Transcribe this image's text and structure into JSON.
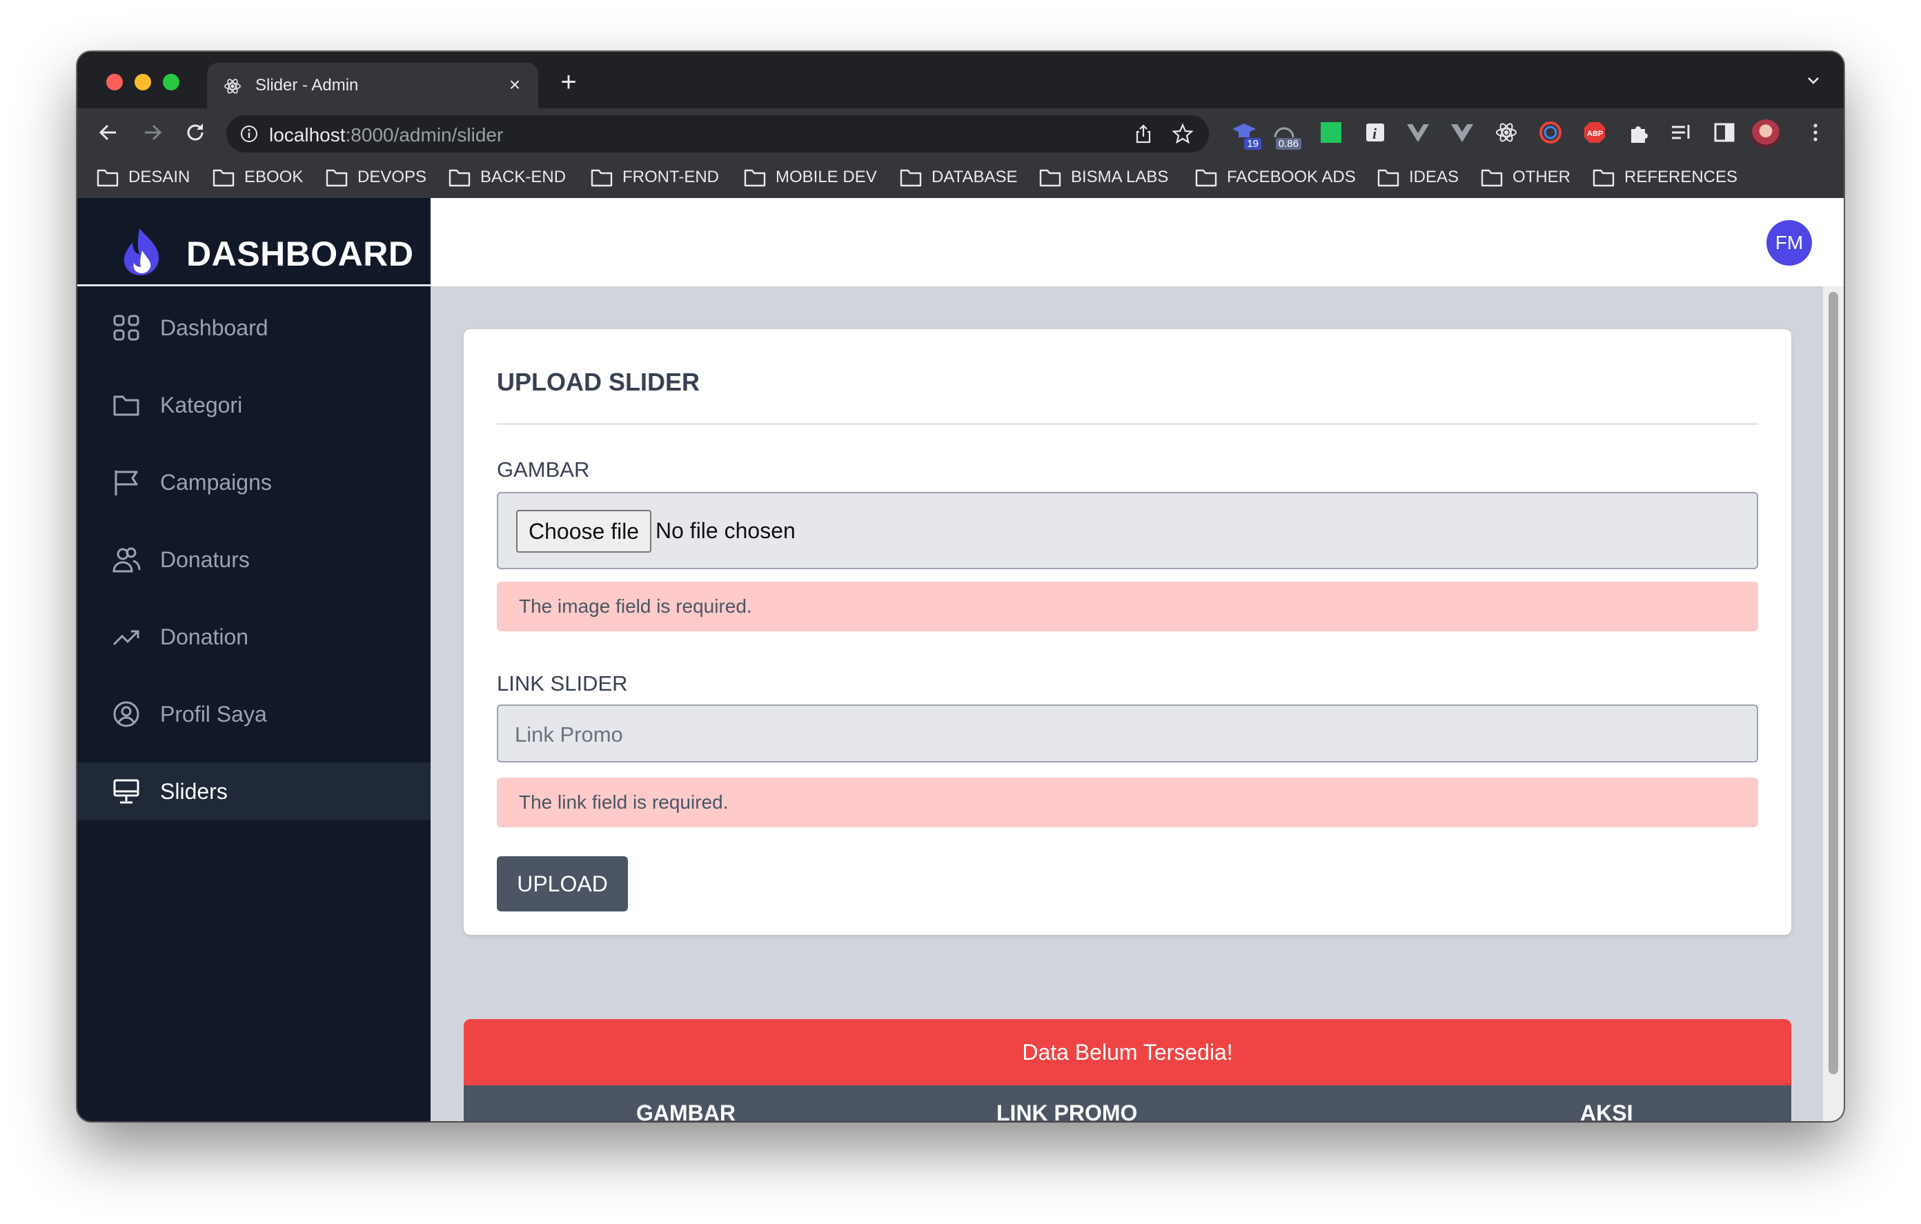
{
  "browser": {
    "tab_title": "Slider - Admin",
    "url_host": "localhost",
    "url_path": ":8000/admin/slider",
    "extensions": [
      {
        "name": "mortarboard-icon",
        "badge": "19"
      },
      {
        "name": "speed-icon",
        "badge": "0.86"
      }
    ],
    "bookmarks": [
      "DESAIN",
      "EBOOK",
      "DEVOPS",
      "BACK-END",
      "FRONT-END",
      "MOBILE DEV",
      "DATABASE",
      "BISMA LABS",
      "FACEBOOK ADS",
      "IDEAS",
      "OTHER",
      "REFERENCES"
    ]
  },
  "sidebar": {
    "brand": "DASHBOARD",
    "items": [
      {
        "label": "Dashboard",
        "icon": "grid-icon",
        "active": false
      },
      {
        "label": "Kategori",
        "icon": "folder-icon",
        "active": false
      },
      {
        "label": "Campaigns",
        "icon": "flag-icon",
        "active": false
      },
      {
        "label": "Donaturs",
        "icon": "users-icon",
        "active": false
      },
      {
        "label": "Donation",
        "icon": "trending-up-icon",
        "active": false
      },
      {
        "label": "Profil Saya",
        "icon": "user-circle-icon",
        "active": false
      },
      {
        "label": "Sliders",
        "icon": "desktop-icon",
        "active": true
      }
    ]
  },
  "topbar": {
    "avatar_initials": "FM"
  },
  "form": {
    "title": "UPLOAD SLIDER",
    "image_label": "GAMBAR",
    "file_button": "Choose file",
    "file_status": "No file chosen",
    "image_error": "The image field is required.",
    "link_label": "LINK SLIDER",
    "link_placeholder": "Link Promo",
    "link_value": "",
    "link_error": "The link field is required.",
    "submit_label": "UPLOAD"
  },
  "table": {
    "empty_message": "Data Belum Tersedia!",
    "columns": [
      "GAMBAR",
      "LINK PROMO",
      "AKSI"
    ]
  },
  "colors": {
    "sidebar_bg": "#111827",
    "accent": "#4f46e5",
    "error_bg": "#fecaca",
    "empty_bg": "#ef4444",
    "table_head": "#4b5563"
  }
}
